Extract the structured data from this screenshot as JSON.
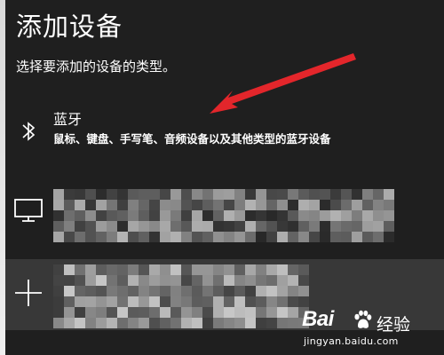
{
  "dialog": {
    "title": "添加设备",
    "subtitle": "选择要添加的设备的类型。"
  },
  "options": {
    "bluetooth": {
      "icon": "bluetooth-icon",
      "title": "蓝牙",
      "description": "鼠标、键盘、手写笔、音频设备以及其他类型的蓝牙设备"
    },
    "display": {
      "icon": "monitor-icon"
    },
    "other": {
      "icon": "plus-icon"
    }
  },
  "annotation": {
    "arrow_color": "#e3262b"
  },
  "watermark": {
    "brand": "Bai",
    "word": "经验",
    "url": "jingyan.baidu.com"
  }
}
